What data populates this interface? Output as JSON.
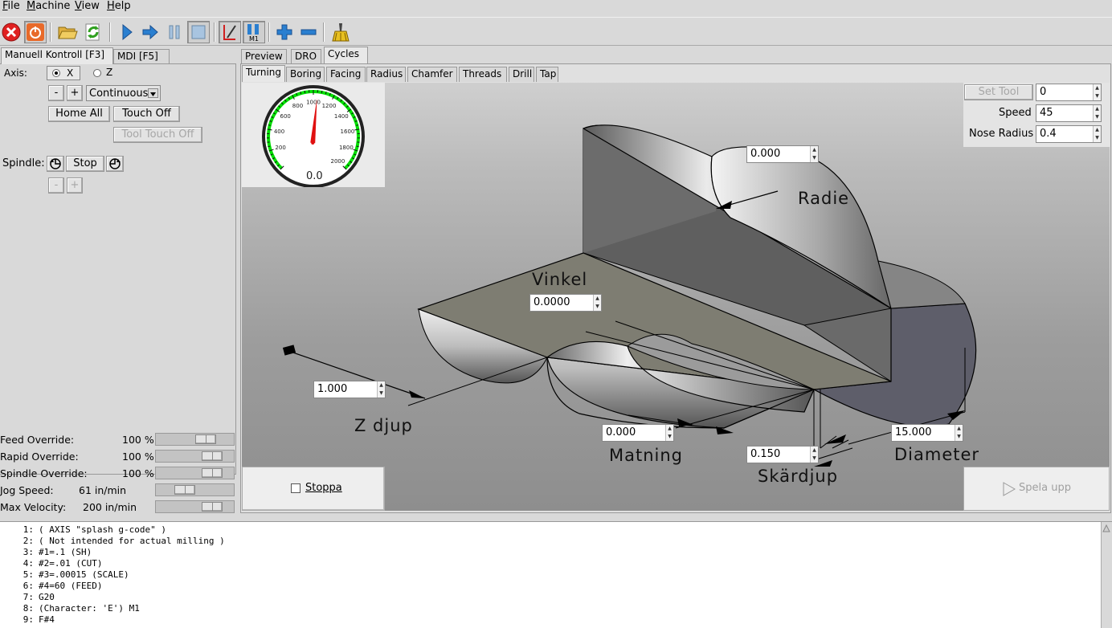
{
  "menubar": {
    "items": [
      "File",
      "Machine",
      "View",
      "Help"
    ]
  },
  "toolbar": {
    "icons": [
      "estop-icon",
      "power-icon",
      "open-file-icon",
      "reload-icon",
      "run-icon",
      "step-icon",
      "pause-icon",
      "stop-icon",
      "block-delete-icon",
      "optional-stop-icon",
      "zoom-in-icon",
      "zoom-out-icon",
      "clear-plot-icon"
    ]
  },
  "left_tabs": [
    "Manuell Kontroll [F3]",
    "MDI [F5]"
  ],
  "manual": {
    "axis_label": "Axis:",
    "axis_x": "X",
    "axis_z": "Z",
    "minus": "-",
    "plus": "+",
    "jog_mode": "Continuous",
    "home_all": "Home All",
    "touch_off": "Touch Off",
    "tool_touch_off": "Tool Touch Off",
    "spindle_label": "Spindle:",
    "spindle_stop": "Stop",
    "spindle_minus": "-",
    "spindle_plus": "+"
  },
  "overrides": [
    {
      "label": "Feed Override:",
      "value": "100 %",
      "level": 0.71
    },
    {
      "label": "Rapid Override:",
      "value": "100 %",
      "level": 0.83
    },
    {
      "label": "Spindle Override:",
      "value": "100 %",
      "level": 0.83
    },
    {
      "label": "Jog Speed:",
      "value": "61 in/min",
      "level": 0.33
    },
    {
      "label": "Max Velocity:",
      "value": "200 in/min",
      "level": 0.83
    }
  ],
  "main_tabs": [
    "Preview",
    "DRO",
    "Cycles"
  ],
  "cycle_tabs": [
    "Turning",
    "Boring",
    "Facing",
    "Radius",
    "Chamfer",
    "Threads",
    "Drill",
    "Tap"
  ],
  "gauge": {
    "ticks": [
      "200",
      "400",
      "600",
      "800",
      "1000",
      "1200",
      "1400",
      "1600",
      "1800",
      "2000"
    ],
    "readout": "0.0",
    "needle_fraction": 0.52,
    "color": "#00e000"
  },
  "tool_panel": {
    "set_tool": "Set Tool",
    "tool_value": "0",
    "speed_label": "Speed",
    "speed_value": "45",
    "nose_radius_label": "Nose Radius",
    "nose_radius_value": "0.4"
  },
  "drawing_labels": {
    "radie": "Radie",
    "vinkel": "Vinkel",
    "z_djup": "Z djup",
    "matning": "Matning",
    "skardjup": "Skärdjup",
    "diameter": "Diameter"
  },
  "drawing_inputs": {
    "radie": "0.000",
    "vinkel": "0.0000",
    "z_djup": "1.000",
    "matning": "0.000",
    "skardjup": "0.150",
    "diameter": "15.000"
  },
  "actions": {
    "stoppa": "Stoppa",
    "spela_upp": "Spela upp"
  },
  "gcode": [
    {
      "n": "1:",
      "t": "( AXIS \"splash g-code\" )"
    },
    {
      "n": "2:",
      "t": "( Not intended for actual milling )"
    },
    {
      "n": "3:",
      "t": "#1=.1 (SH)"
    },
    {
      "n": "4:",
      "t": "#2=.01 (CUT)"
    },
    {
      "n": "5:",
      "t": "#3=.00015 (SCALE)"
    },
    {
      "n": "6:",
      "t": "#4=60 (FEED)"
    },
    {
      "n": "7:",
      "t": "G20"
    },
    {
      "n": "8:",
      "t": "(Character: 'E') M1"
    },
    {
      "n": "9:",
      "t": "F#4"
    }
  ]
}
